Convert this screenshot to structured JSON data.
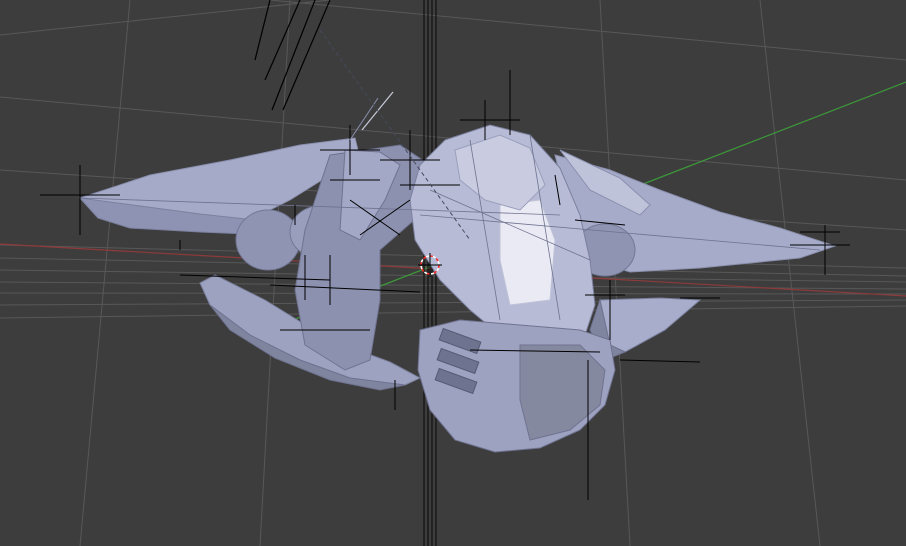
{
  "viewport": {
    "background_color": "#3d3d3d",
    "grid_color": "#555555",
    "axis_x_color": "#9a3c3c",
    "axis_y_color": "#3f9a3c",
    "mesh_color": "#a3a8c6",
    "mesh_shadow_color": "#6f7390",
    "mesh_highlight_color": "#e8e9f2",
    "empty_object_color": "#000000",
    "cursor_color_primary": "#ff3030",
    "cursor_color_secondary": "#ffffff",
    "show_grid": true,
    "cursor_icon": "3d-cursor-icon",
    "object_icon": "spaceship-mesh"
  }
}
